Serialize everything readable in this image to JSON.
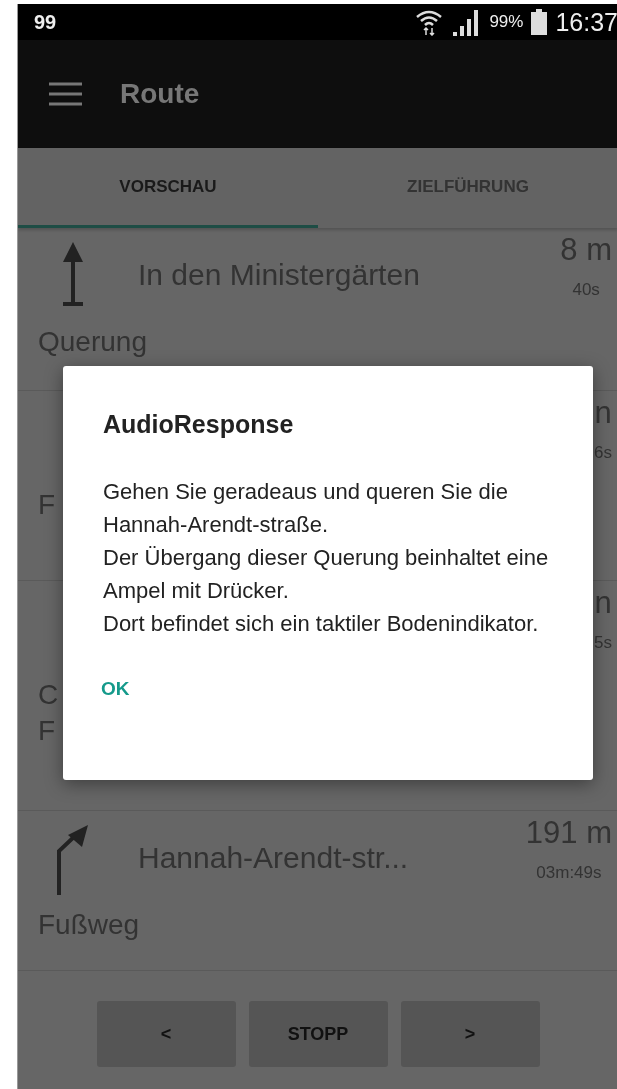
{
  "status_bar": {
    "notification": "99",
    "battery": "99%",
    "time": "16:37"
  },
  "app_bar": {
    "title": "Route"
  },
  "tabs": [
    {
      "label": "VORSCHAU",
      "selected": true
    },
    {
      "label": "ZIELFÜHRUNG",
      "selected": false
    }
  ],
  "steps": [
    {
      "kind": "straight",
      "name": "In den Ministergärten",
      "distance": "8 m",
      "duration": "40s",
      "type_lines": [
        "Querung"
      ]
    },
    {
      "kind": "hidden",
      "distance": "n",
      "duration": "6s",
      "type_lines": [
        "F"
      ]
    },
    {
      "kind": "hidden",
      "distance": "n",
      "duration": "5s",
      "type_lines": [
        "C",
        "F"
      ]
    },
    {
      "kind": "turn_right",
      "name": "Hannah-Arendt-str...",
      "distance": "191 m",
      "duration": "03m:49s",
      "type_lines": [
        "Fußweg"
      ]
    }
  ],
  "buttons": [
    {
      "label": "<"
    },
    {
      "label": "STOPP"
    },
    {
      "label": ">"
    }
  ],
  "dialog": {
    "title": "AudioResponse",
    "message": "Gehen Sie geradeaus und queren Sie die Hannah-Arendt-straße.\nDer Übergang dieser Querung beinhaltet eine Ampel mit Drücker.\nDort befindet sich ein taktiler Bodenindikator.",
    "action": "OK"
  }
}
